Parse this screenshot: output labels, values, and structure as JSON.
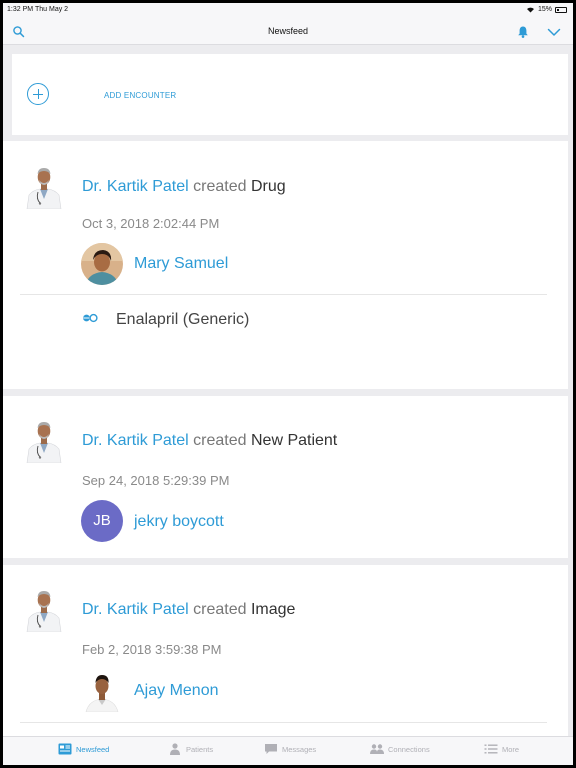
{
  "status_bar": {
    "time": "1:32 PM",
    "date": "Thu May 2",
    "battery": "15%"
  },
  "navbar": {
    "title": "Newsfeed",
    "icons": [
      "search-icon",
      "bell-icon",
      "chevron-down-icon"
    ]
  },
  "add_encounter": {
    "label": "ADD ENCOUNTER",
    "icon": "plus-circle-icon"
  },
  "feed": [
    {
      "author": "Dr. Kartik Patel",
      "verb": "created",
      "object": "Drug",
      "timestamp": "Oct 3, 2018 2:02:44 PM",
      "patient": "Mary Samuel",
      "drug": "Enalapril (Generic)"
    },
    {
      "author": "Dr. Kartik Patel",
      "verb": "created",
      "object": "New Patient",
      "timestamp": "Sep 24, 2018 5:29:39 PM",
      "patient": "jekry boycott",
      "patient_initials": "JB"
    },
    {
      "author": "Dr. Kartik Patel",
      "verb": "created",
      "object": "Image",
      "timestamp": "Feb 2, 2018 3:59:38 PM",
      "patient": "Ajay Menon"
    }
  ],
  "tabbar": {
    "tabs": [
      {
        "label": "Newsfeed",
        "icon": "newsfeed-icon",
        "active": true
      },
      {
        "label": "Patients",
        "icon": "patients-icon",
        "active": false
      },
      {
        "label": "Messages",
        "icon": "messages-icon",
        "active": false
      },
      {
        "label": "Connections",
        "icon": "connections-icon",
        "active": false
      },
      {
        "label": "More",
        "icon": "more-list-icon",
        "active": false
      }
    ]
  },
  "colors": {
    "accent": "#2e9bd6",
    "initials_avatar": "#6b6bc6"
  }
}
